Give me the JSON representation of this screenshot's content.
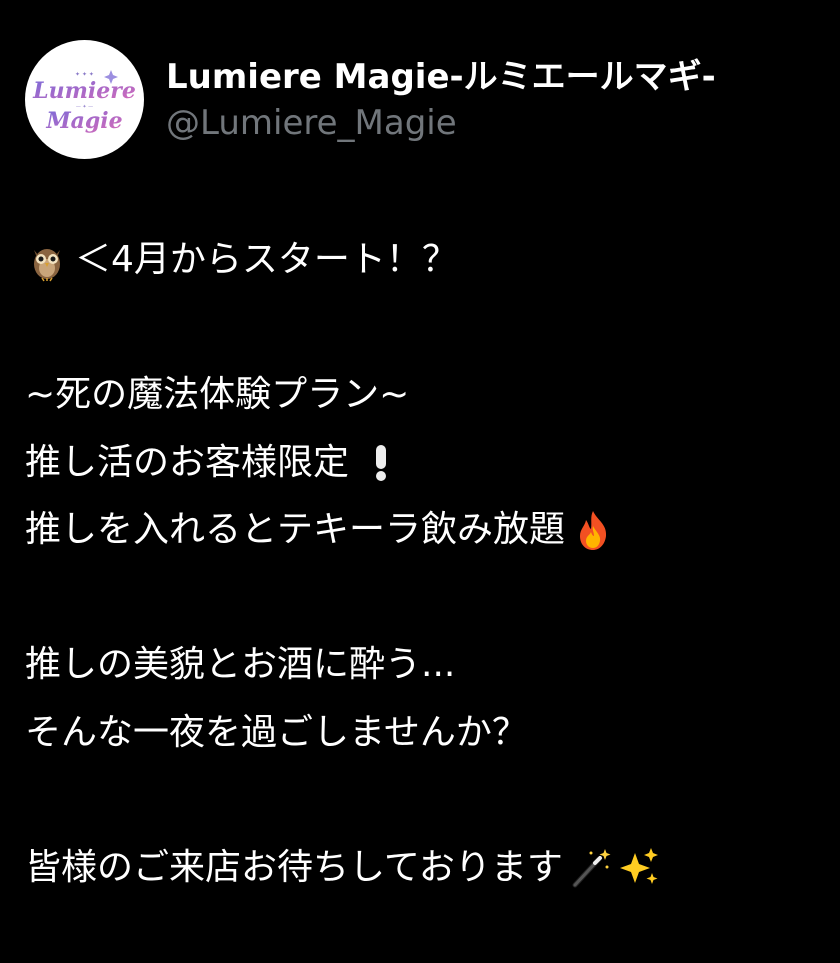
{
  "account": {
    "display_name": "Lumiere Magie-ルミエールマギ-",
    "handle": "@Lumiere_Magie",
    "avatar_logo_text": "Lumiere Magie"
  },
  "post": {
    "line1_text": "＜4月からスタート！？",
    "line1_icon": "owl-emoji",
    "line2_text": "~死の魔法体験プラン~",
    "line3_text": "推し活のお客様限定",
    "line3_icon": "exclamation-emoji",
    "line4_text": "推しを入れるとテキーラ飲み放題",
    "line4_icon": "fire-emoji",
    "line5_text": "推しの美貌とお酒に酔う...",
    "line6_text": "そんな一夜を過ごしませんか？",
    "line7_text": "皆様のご来店お待ちしております",
    "line7_icons": [
      "magic-wand-emoji",
      "sparkles-emoji"
    ]
  },
  "colors": {
    "background": "#000000",
    "text": "#ffffff",
    "handle": "#71767b",
    "logo_purple": "#6a4fc4",
    "logo_pink": "#d86ab8"
  }
}
